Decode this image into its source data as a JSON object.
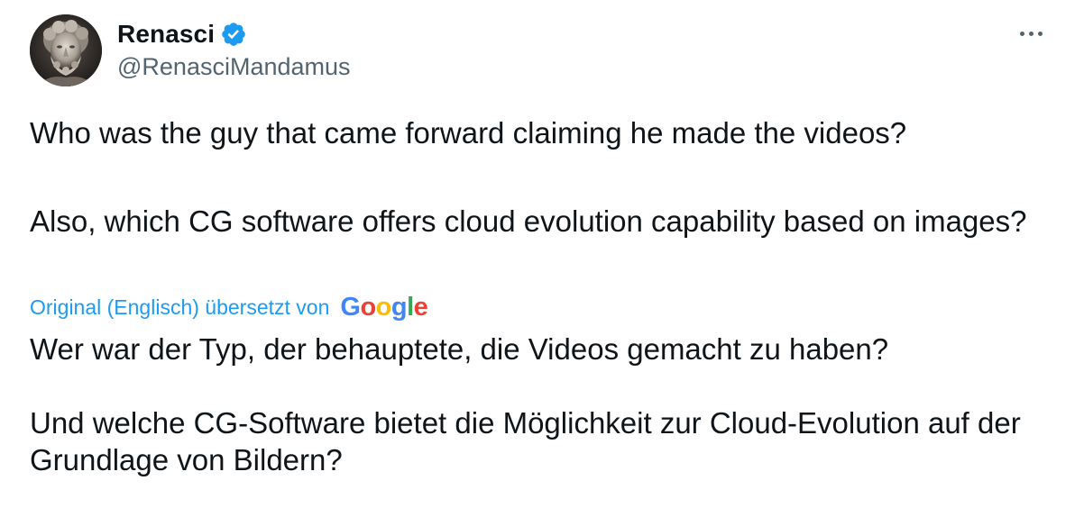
{
  "author": {
    "display_name": "Renasci",
    "handle": "@RenasciMandamus",
    "verified": true,
    "avatar_icon": "marble-bust-avatar"
  },
  "menu": {
    "icon": "more-options-icon"
  },
  "tweet": {
    "original_paragraphs": [
      "Who was the guy that came forward claiming he made the videos?",
      "Also, which CG software offers cloud evolution capability based on images?"
    ],
    "translation_label": "Original (Englisch) übersetzt von",
    "translation_provider": "Google",
    "translated_paragraphs": [
      "Wer war der Typ, der behauptete, die Videos gemacht zu haben?",
      "Und welche CG-Software bietet die Möglichkeit zur Cloud-Evolution auf der Grundlage von Bildern?"
    ]
  },
  "colors": {
    "link": "#1d9bf0",
    "secondary_text": "#536471",
    "primary_text": "#0f1419",
    "verified_badge": "#1d9bf0"
  }
}
